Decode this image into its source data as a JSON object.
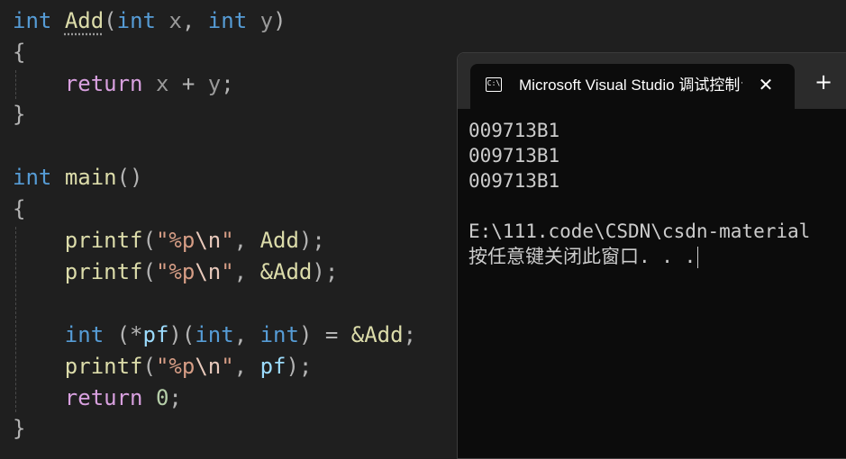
{
  "editor": {
    "l1": {
      "kw_int": "int",
      "fn_add": "Add",
      "open": "(",
      "kw_int2": "int",
      "px": "x",
      "comma": ", ",
      "kw_int3": "int",
      "py": "y",
      "close": ")"
    },
    "l2": {
      "brace": "{"
    },
    "l3": {
      "kw_return": "return",
      "expr_x": "x",
      "op_plus": "+",
      "expr_y": "y",
      "semi": ";"
    },
    "l4": {
      "brace": "}"
    },
    "l6": {
      "kw_int": "int",
      "fn_main": "main",
      "parens": "()"
    },
    "l7": {
      "brace": "{"
    },
    "l8": {
      "fn_printf": "printf",
      "open": "(",
      "str_a": "\"%p",
      "esc": "\\n",
      "str_b": "\"",
      "comma": ", ",
      "arg": "Add",
      "close": ");"
    },
    "l9": {
      "fn_printf": "printf",
      "open": "(",
      "str_a": "\"%p",
      "esc": "\\n",
      "str_b": "\"",
      "comma": ", ",
      "arg": "&Add",
      "close": ");"
    },
    "l11": {
      "kw_int": "int",
      "open": "(*",
      "var_pf": "pf",
      "close_paren": ")",
      "open2": "(",
      "kw_int2": "int",
      "comma": ", ",
      "kw_int3": "int",
      "close2": ")",
      "assign": " = ",
      "arg": "&Add",
      "semi": ";"
    },
    "l12": {
      "fn_printf": "printf",
      "open": "(",
      "str_a": "\"%p",
      "esc": "\\n",
      "str_b": "\"",
      "comma": ", ",
      "var_pf": "pf",
      "close": ");"
    },
    "l13": {
      "kw_return": "return",
      "num": "0",
      "semi": ";"
    },
    "l14": {
      "brace": "}"
    }
  },
  "terminal": {
    "tab_title": "Microsoft Visual Studio 调试控制台",
    "tab_icon": "console-icon",
    "tab_icon_glyph": "C:\\",
    "close_glyph": "✕",
    "new_tab_glyph": "+",
    "lines": [
      "009713B1",
      "009713B1",
      "009713B1",
      "",
      "E:\\111.code\\CSDN\\csdn-material",
      "按任意键关闭此窗口. . ."
    ]
  },
  "colors": {
    "editor_bg": "#1f1f1f",
    "keyword": "#569cd6",
    "control_keyword": "#d8a0df",
    "function": "#dcdcaa",
    "string": "#d69d85",
    "terminal_bg": "#0c0c0c",
    "tab_strip": "#2b2b2b"
  }
}
